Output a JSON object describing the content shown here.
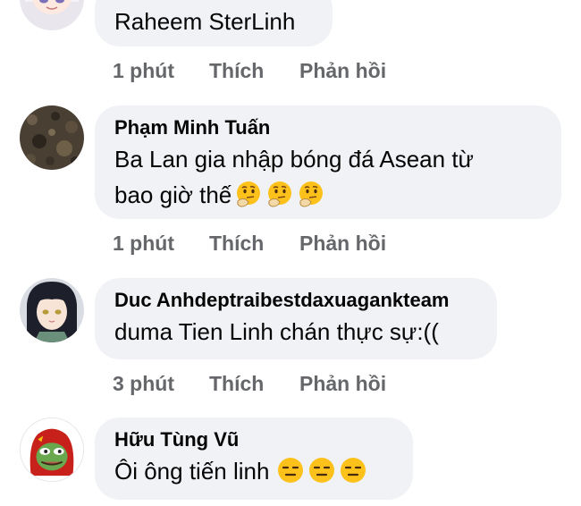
{
  "comments": [
    {
      "author": "",
      "text": "Raheem SterLinh",
      "time": "1 phút",
      "like_label": "Thích",
      "reply_label": "Phản hồi",
      "avatar": "anime-girl-white-hair-avatar"
    },
    {
      "author": "Phạm Minh Tuấn",
      "text_line1": "Ba Lan gia nhập bóng đá Asean từ",
      "text_line2": "bao giờ thế",
      "emojis": [
        "thinking-emoji",
        "thinking-emoji",
        "thinking-emoji"
      ],
      "time": "1 phút",
      "like_label": "Thích",
      "reply_label": "Phản hồi",
      "avatar": "dark-texture-avatar"
    },
    {
      "author": "Duc Anhdeptraibestdaxuagankteam",
      "text": "duma Tien Linh chán thực sự:((",
      "time": "3 phút",
      "like_label": "Thích",
      "reply_label": "Phản hồi",
      "avatar": "anime-girl-dark-hair-avatar"
    },
    {
      "author": "Hữu Tùng Vũ",
      "text": "Ôi ông tiến linh",
      "emojis": [
        "expressionless-emoji",
        "expressionless-emoji",
        "expressionless-emoji"
      ],
      "avatar": "pepe-frog-red-hood-avatar"
    }
  ],
  "colors": {
    "bubble": "#f0f2f5",
    "action_text": "#65676b",
    "emoji_yellow": "#fcc21b"
  }
}
